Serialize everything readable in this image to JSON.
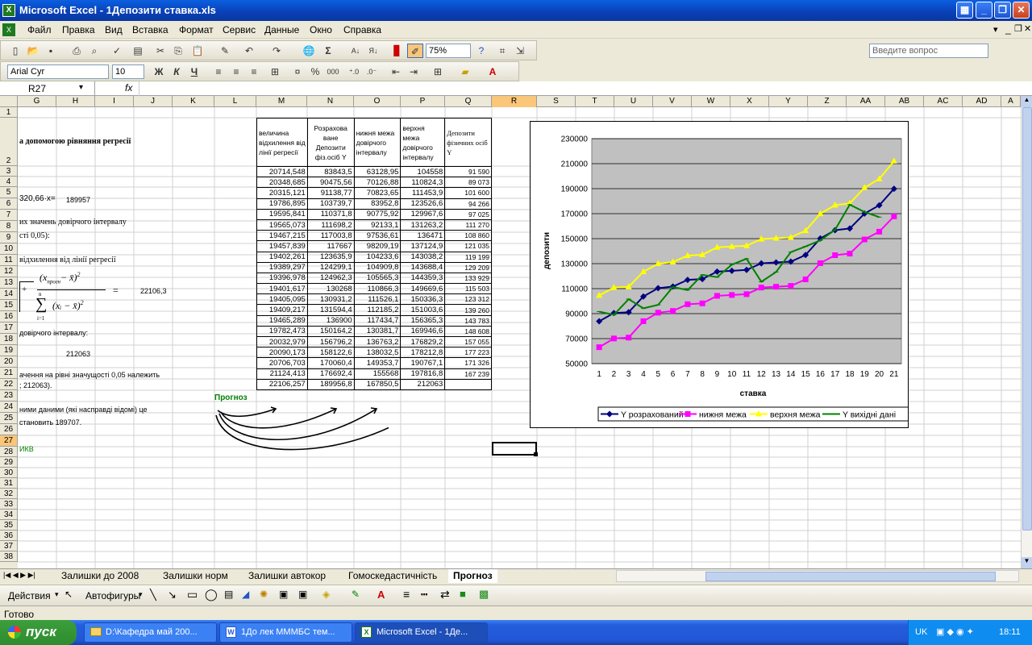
{
  "window": {
    "title": "Microsoft Excel - 1Депозити ставка.xls",
    "ask_placeholder": "Введите вопрос"
  },
  "menu": [
    "Файл",
    "Правка",
    "Вид",
    "Вставка",
    "Формат",
    "Сервис",
    "Данные",
    "Окно",
    "Справка"
  ],
  "toolbar": {
    "zoom": "75%",
    "font": "Arial Cyr",
    "size": "10",
    "bold": "Ж",
    "italic": "К",
    "underline": "Ч",
    "percent": "%",
    "thousands": "000",
    "sigma": "Σ",
    "fx": "fx"
  },
  "namebox": "R27",
  "columns": [
    "G",
    "H",
    "I",
    "J",
    "K",
    "L",
    "M",
    "N",
    "O",
    "P",
    "Q",
    "R",
    "S",
    "T",
    "U",
    "V",
    "W",
    "X",
    "Y",
    "Z",
    "AA",
    "AB",
    "AC",
    "AD",
    "A"
  ],
  "rows": [
    "1",
    "2",
    "3",
    "4",
    "5",
    "6",
    "7",
    "8",
    "9",
    "10",
    "11",
    "12",
    "13",
    "14",
    "15",
    "16",
    "17",
    "18",
    "19",
    "20",
    "21",
    "22",
    "23",
    "24",
    "25",
    "26",
    "27",
    "28",
    "29",
    "30",
    "31",
    "32",
    "33",
    "34",
    "35",
    "36",
    "37",
    "38"
  ],
  "left_text": {
    "r2": "а допомогою рівняння регресії",
    "r5a": "320,66·x=",
    "r5b": "189957",
    "r7": "их значень довірчого інтервалу",
    "r8": "сті 0,05):",
    "r10": "відхилення від лінії регресії",
    "r13": "22106,3",
    "f_top": "(x",
    "f_sub": "прогн",
    "f_minus": "− x̄)",
    "f_sup": "2",
    "f_sum": "∑",
    "f_n": "n",
    "f_i": "i=1",
    "f_bot": "(xᵢ − x̄)",
    "f_eq": "=",
    "f_plus": "+",
    "r17": "довірчого інтервалу:",
    "r19": "212063",
    "r21": "ачення на рівні значущості 0,05 належить",
    "r22": "; 212063).",
    "r24": "ними даними (які насправді відомі) це",
    "r25": "становить 189707.",
    "r27": "ИКВ",
    "forecast": "Прогноз"
  },
  "table": {
    "headers": [
      "величина відхилення від лінії регресії",
      "Розрахова ване Депозити фіз.осіб Y",
      "нижня межа довірчого інтервалу",
      "верхня межа довірчого інтервалу",
      "Депозити фізичних осіб Y"
    ],
    "rows": [
      [
        "20714,548",
        "83843,5",
        "63128,95",
        "104558",
        "91 590"
      ],
      [
        "20348,685",
        "90475,56",
        "70126,88",
        "110824,3",
        "89 073"
      ],
      [
        "20315,121",
        "91138,77",
        "70823,65",
        "111453,9",
        "101 600"
      ],
      [
        "19786,895",
        "103739,7",
        "83952,8",
        "123526,6",
        "94 266"
      ],
      [
        "19595,841",
        "110371,8",
        "90775,92",
        "129967,6",
        "97 025"
      ],
      [
        "19565,073",
        "111698,2",
        "92133,1",
        "131263,2",
        "111 270"
      ],
      [
        "19467,215",
        "117003,8",
        "97536,61",
        "136471",
        "108 860"
      ],
      [
        "19457,839",
        "117667",
        "98209,19",
        "137124,9",
        "121 035"
      ],
      [
        "19402,261",
        "123635,9",
        "104233,6",
        "143038,2",
        "119 199"
      ],
      [
        "19389,297",
        "124299,1",
        "104909,8",
        "143688,4",
        "129 209"
      ],
      [
        "19396,978",
        "124962,3",
        "105565,3",
        "144359,3",
        "133 929"
      ],
      [
        "19401,617",
        "130268",
        "110866,3",
        "149669,6",
        "115 503"
      ],
      [
        "19405,095",
        "130931,2",
        "111526,1",
        "150336,3",
        "123 312"
      ],
      [
        "19409,217",
        "131594,4",
        "112185,2",
        "151003,6",
        "139 260"
      ],
      [
        "19465,289",
        "136900",
        "117434,7",
        "156365,3",
        "143 783"
      ],
      [
        "19782,473",
        "150164,2",
        "130381,7",
        "169946,6",
        "148 608"
      ],
      [
        "20032,979",
        "156796,2",
        "136763,2",
        "176829,2",
        "157 055"
      ],
      [
        "20090,173",
        "158122,6",
        "138032,5",
        "178212,8",
        "177 223"
      ],
      [
        "20706,703",
        "170060,4",
        "149353,7",
        "190767,1",
        "171 326"
      ],
      [
        "21124,413",
        "176692,4",
        "155568",
        "197816,8",
        "167 239"
      ],
      [
        "22106,257",
        "189956,8",
        "167850,5",
        "212063",
        ""
      ]
    ]
  },
  "chart_data": {
    "type": "line",
    "xlabel": "ставка",
    "ylabel": "депозити",
    "ylim": [
      50000,
      230000
    ],
    "yticks": [
      "230000",
      "210000",
      "190000",
      "170000",
      "150000",
      "130000",
      "110000",
      "90000",
      "70000",
      "50000"
    ],
    "x": [
      "1",
      "2",
      "3",
      "4",
      "5",
      "6",
      "7",
      "8",
      "9",
      "10",
      "11",
      "12",
      "13",
      "14",
      "15",
      "16",
      "17",
      "18",
      "19",
      "20",
      "21"
    ],
    "legend_position": "bottom",
    "grid": true,
    "series": [
      {
        "name": "Y розрахований",
        "color": "#000080",
        "values": [
          83843.5,
          90475.56,
          91138.77,
          103739.7,
          110371.8,
          111698.2,
          117003.8,
          117667,
          123635.9,
          124299.1,
          124962.3,
          130268,
          130931.2,
          131594.4,
          136900,
          150164.2,
          156796.2,
          158122.6,
          170060.4,
          176692.4,
          189956.8
        ]
      },
      {
        "name": "нижня межа",
        "color": "#ff00ff",
        "values": [
          63128.95,
          70126.88,
          70823.65,
          83952.8,
          90775.92,
          92133.1,
          97536.61,
          98209.19,
          104233.6,
          104909.8,
          105565.3,
          110866.3,
          111526.1,
          112185.2,
          117434.7,
          130381.7,
          136763.2,
          138032.5,
          149353.7,
          155568,
          167850.5
        ]
      },
      {
        "name": "верхня межа",
        "color": "#ffff00",
        "values": [
          104558,
          110824.3,
          111453.9,
          123526.6,
          129967.6,
          131263.2,
          136471,
          137124.9,
          143038.2,
          143688.4,
          144359.3,
          149669.6,
          150336.3,
          151003.6,
          156365.3,
          169946.6,
          176829.2,
          178212.8,
          190767.1,
          197816.8,
          212063
        ]
      },
      {
        "name": "Y вихідні дані",
        "color": "#008000",
        "values": [
          91590,
          89073,
          101600,
          94266,
          97025,
          111270,
          108860,
          121035,
          119199,
          129209,
          133929,
          115503,
          123312,
          139260,
          143783,
          148608,
          157055,
          177223,
          171326,
          167239
        ]
      }
    ]
  },
  "sheets": [
    "Залишки до 2008",
    "Залишки норм",
    "Залишки автокор",
    "Гомоскедастичність",
    "Прогноз"
  ],
  "drawbar": {
    "actions": "Действия",
    "autoshapes": "Автофигуры"
  },
  "status": "Готово",
  "taskbar": {
    "start": "пуск",
    "tasks": [
      "D:\\Кафедра май 200...",
      "1До лек МММБС тем...",
      "Microsoft Excel - 1Де..."
    ],
    "lang": "UK",
    "clock": "18:11"
  }
}
